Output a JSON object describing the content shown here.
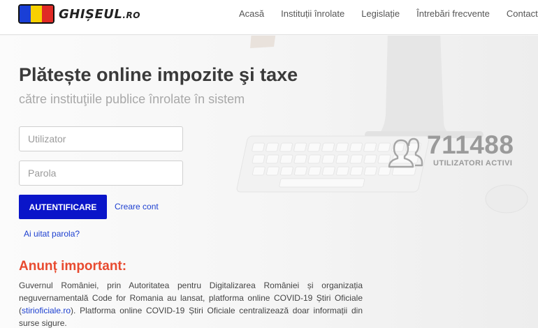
{
  "brand": {
    "logo_text": "GHIȘEUL",
    "logo_suffix": ".RO",
    "flag_colors": [
      "#1a3fd6",
      "#f7d000",
      "#e02a25"
    ]
  },
  "nav": {
    "items": [
      {
        "label": "Acasă"
      },
      {
        "label": "Instituții înrolate"
      },
      {
        "label": "Legislație"
      },
      {
        "label": "Întrebări frecvente"
      },
      {
        "label": "Contact"
      }
    ]
  },
  "hero": {
    "title": "Plătește online impozite şi taxe",
    "subtitle": "către instituţiile publice înrolate în sistem"
  },
  "login": {
    "username_placeholder": "Utilizator",
    "password_placeholder": "Parola",
    "submit_label": "AUTENTIFICARE",
    "create_account_label": "Creare cont",
    "forgot_password_label": "Ai uitat parola?"
  },
  "stats": {
    "active_users_count": "711488",
    "active_users_label": "UTILIZATORI ACTIVI",
    "icon": "users-icon"
  },
  "announcement": {
    "title": "Anunț important:",
    "text_before_link": "Guvernul României, prin Autoritatea pentru Digitalizarea României și organizația neguvernamentală Code for Romania au lansat, platforma online COVID-19 Știri Oficiale (",
    "link_text": "stirioficiale.ro",
    "text_after_link": "). Platforma online COVID-19 Știri Oficiale centralizează doar informații din surse sigure."
  },
  "colors": {
    "primary_button": "#0a15c9",
    "link": "#1c3fd0",
    "announcement_title": "#e84a2f",
    "stat_text": "#9a9a9a"
  }
}
